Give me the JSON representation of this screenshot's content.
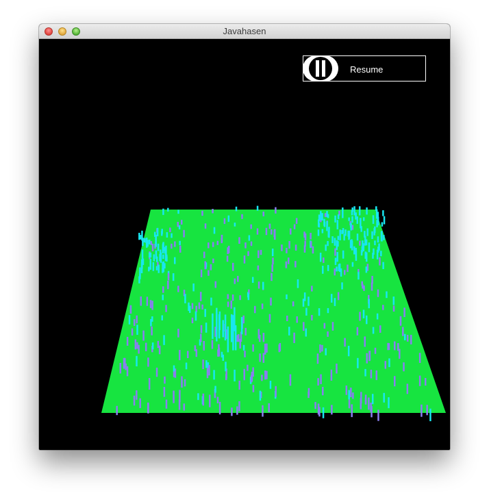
{
  "window": {
    "title": "Javahasen"
  },
  "controls": {
    "resume_label": "Resume"
  },
  "colors": {
    "field": "#17e440",
    "agent_purple": "#8a7ef0",
    "agent_cyan": "#19e6f0",
    "background": "#000000"
  },
  "icons": {
    "pause": "pause-icon"
  }
}
